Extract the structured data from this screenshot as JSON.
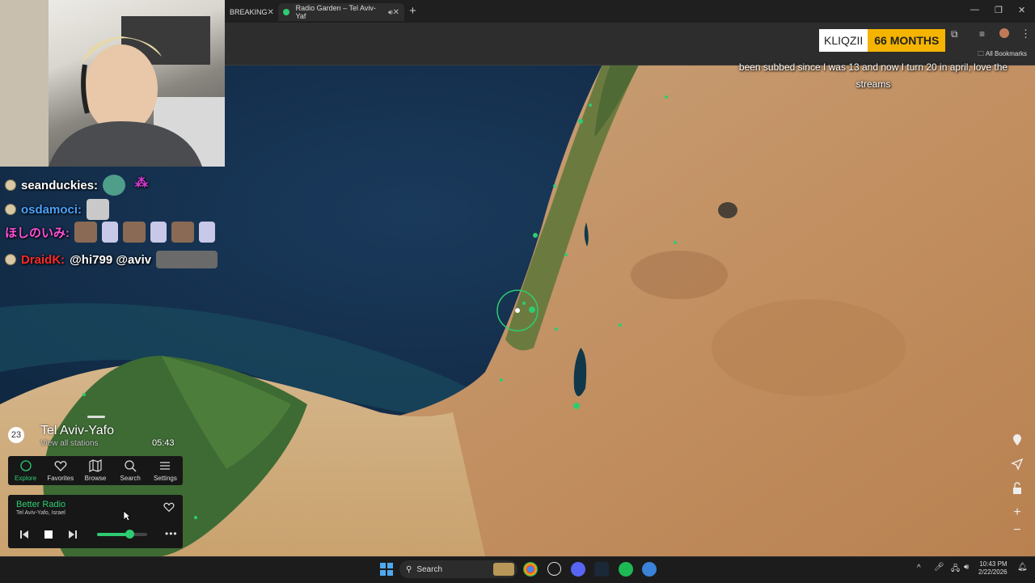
{
  "browser": {
    "tabs": [
      {
        "label": "BREAKING"
      },
      {
        "label": "Radio Garden – Tel Aviv-Yaf"
      }
    ],
    "bookmarks_label": "All Bookmarks"
  },
  "stream_overlay": {
    "chat": [
      {
        "user": "seanduckies:",
        "color": "#ffffff",
        "message": ""
      },
      {
        "user": "osdamoci:",
        "color": "#4aa3ff",
        "message": ""
      },
      {
        "user": "ほしのいみ:",
        "color": "#ff4fd8",
        "message": ""
      },
      {
        "user": "DraidK:",
        "color": "#ff2a2a",
        "message": "@hi799 @aviv"
      }
    ],
    "sub_alert": {
      "name": "KLIQZII",
      "months": "66 MONTHS"
    },
    "sub_message": "been subbed since I was 13 and now I turn 20 in april, love the streams"
  },
  "radio": {
    "station_count": "23",
    "city": "Tel Aviv-Yafo",
    "view_all": "View all stations",
    "local_time": "05:43",
    "nav": [
      {
        "label": "Explore",
        "icon": "explore-icon"
      },
      {
        "label": "Favorites",
        "icon": "heart-icon"
      },
      {
        "label": "Browse",
        "icon": "map-icon"
      },
      {
        "label": "Search",
        "icon": "search-icon"
      },
      {
        "label": "Settings",
        "icon": "menu-icon"
      }
    ],
    "player": {
      "station": "Better Radio",
      "location": "Tel Aviv-Yafo, Israel",
      "volume": 0.64
    }
  },
  "taskbar": {
    "search_label": "Search",
    "time": "10:43 PM",
    "date": "2/22/2026"
  },
  "colors": {
    "accent": "#2ecc71",
    "sub_gold": "#f4b400"
  }
}
